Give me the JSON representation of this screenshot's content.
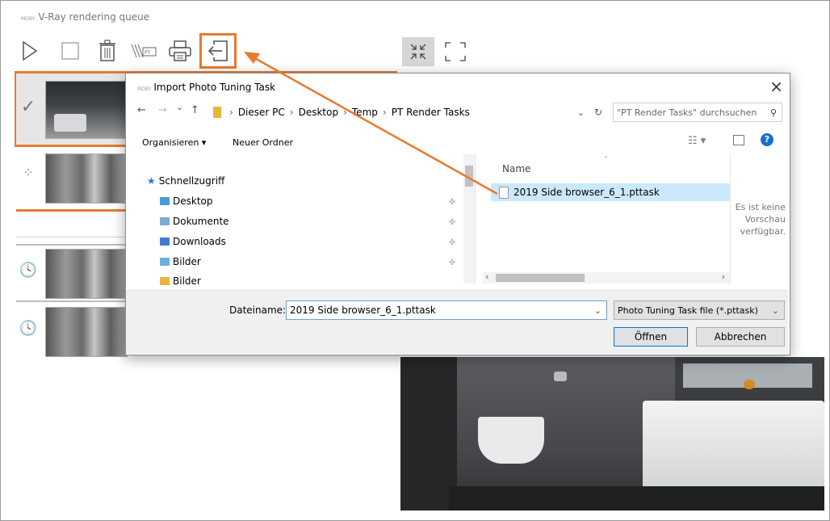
{
  "app": {
    "logo": "MOBY",
    "title": "V-Ray rendering queue"
  },
  "toolbar": {
    "play": "play-icon",
    "stop": "stop-icon",
    "delete": "trash-icon",
    "photo_tuning": "photo-tuning-icon",
    "print": "printer-icon",
    "import": "import-icon",
    "collapse": "collapse-icon",
    "fullscreen": "fullscreen-icon"
  },
  "queue": [
    {
      "status": "done",
      "status_glyph": "✓"
    },
    {
      "status": "rendering",
      "status_glyph": "⁘"
    },
    {
      "status": "waiting",
      "status_glyph": "🕓"
    },
    {
      "status": "waiting",
      "status_glyph": "🕓"
    }
  ],
  "dialog": {
    "logo": "MOBY",
    "title": "Import Photo Tuning Task",
    "close": "×",
    "nav": {
      "back": "←",
      "forward": "→",
      "recent": "⌄",
      "up": "↑"
    },
    "breadcrumb": [
      "Dieser PC",
      "Desktop",
      "Temp",
      "PT Render Tasks"
    ],
    "search_placeholder": "\"PT Render Tasks\" durchsuchen",
    "organize_label": "Organisieren ▾",
    "new_folder_label": "Neuer Ordner",
    "quick_access": "Schnellzugriff",
    "nav_items": [
      "Desktop",
      "Dokumente",
      "Downloads",
      "Bilder",
      "Bilder"
    ],
    "column_name": "Name",
    "files": [
      "2019 Side browser_6_1.pttask"
    ],
    "preview_text": "Es ist keine Vorschau verfügbar.",
    "filename_label": "Dateiname:",
    "filename_value": "2019 Side browser_6_1.pttask",
    "filetype_value": "Photo Tuning Task file (*.pttask)",
    "open_label": "Öffnen",
    "cancel_label": "Abbrechen"
  },
  "colors": {
    "highlight": "#e87a2e",
    "selection": "#cce8ff",
    "accent_blue": "#1a6fc9"
  }
}
